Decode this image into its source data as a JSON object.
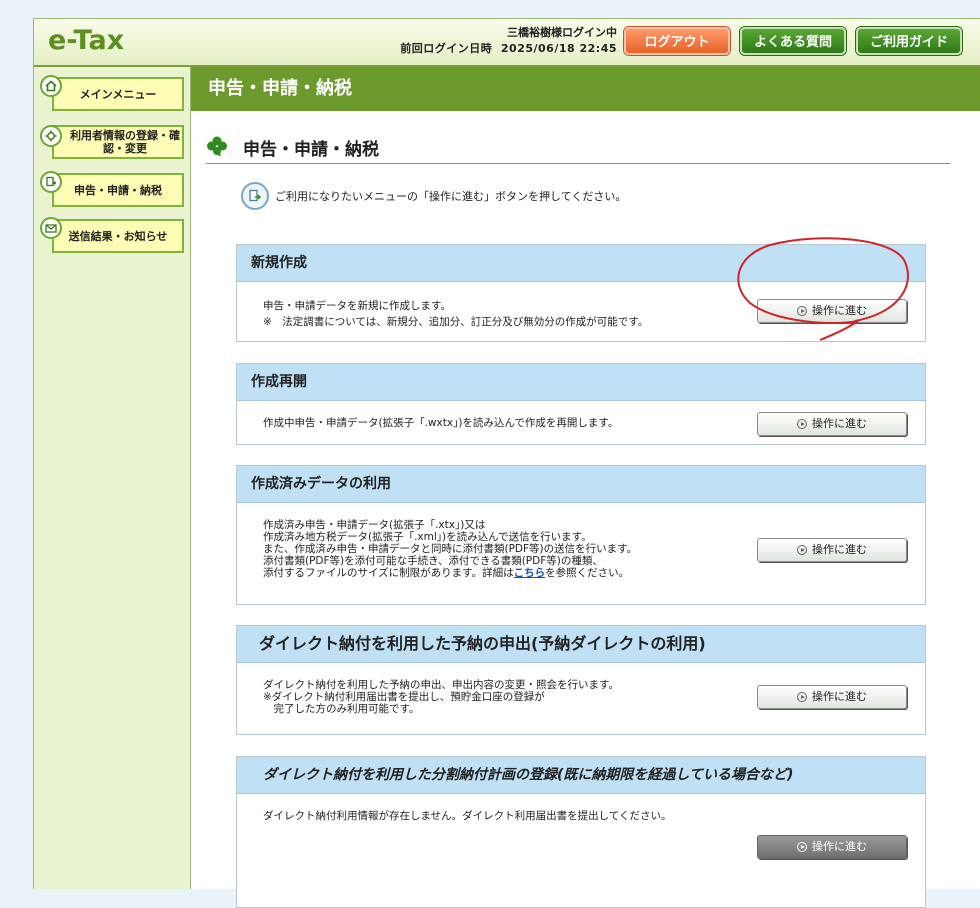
{
  "header": {
    "logo": "e-Tax",
    "user_status": "三橋裕樹様ログイン中",
    "last_login_label": "前回ログイン日時",
    "last_login_time": "2025/06/18 22:45",
    "logout_label": "ログアウト",
    "faq_label": "よくある質問",
    "guide_label": "ご利用ガイド"
  },
  "sidebar": {
    "items": [
      {
        "label": "メインメニュー"
      },
      {
        "label": "利用者情報の登録・確認・変更"
      },
      {
        "label": "申告・申請・納税"
      },
      {
        "label": "送信結果・お知らせ"
      }
    ]
  },
  "main": {
    "banner": "申告・申請・納税",
    "section_title": "申告・申請・納税",
    "guidance": "ご利用になりたいメニューの「操作に進む」ボタンを押してください。",
    "button_label": "操作に進む",
    "boxes": [
      {
        "title": "新規作成",
        "lines": [
          "申告・申請データを新規に作成します。",
          "※　法定調書については、新規分、追加分、訂正分及び無効分の作成が可能です。"
        ]
      },
      {
        "title": "作成再開",
        "lines": [
          "作成中申告・申請データ(拡張子「.wxtx」)を読み込んで作成を再開します。"
        ]
      },
      {
        "title": "作成済みデータの利用",
        "lines": [
          "作成済み申告・申請データ(拡張子「.xtx」)又は",
          "作成済み地方税データ(拡張子「.xml」)を読み込んで送信を行います。",
          "また、作成済み申告・申請データと同時に添付書類(PDF等)の送信を行います。",
          "添付書類(PDF等)を添付可能な手続き、添付できる書類(PDF等)の種類、",
          "添付するファイルのサイズに制限があります。詳細は"
        ],
        "link": "こちら",
        "link_suffix": "を参照ください。"
      },
      {
        "title": "ダイレクト納付を利用した予納の申出(予納ダイレクトの利用)",
        "lines": [
          "ダイレクト納付を利用した予納の申出、申出内容の変更・照会を行います。",
          "※ダイレクト納付利用届出書を提出し、預貯金口座の登録が",
          "　完了した方のみ利用可能です。"
        ]
      },
      {
        "title": "ダイレクト納付を利用した分割納付計画の登録(既に納期限を経過している場合など)",
        "lines": [
          "ダイレクト納付利用情報が存在しません。ダイレクト利用届出書を提出してください。"
        ]
      }
    ]
  },
  "colors": {
    "accent_green": "#6d9a2c",
    "box_header_blue": "#bfe0f5",
    "logout_orange": "#e8612a",
    "annotation_red": "#d2232a"
  }
}
